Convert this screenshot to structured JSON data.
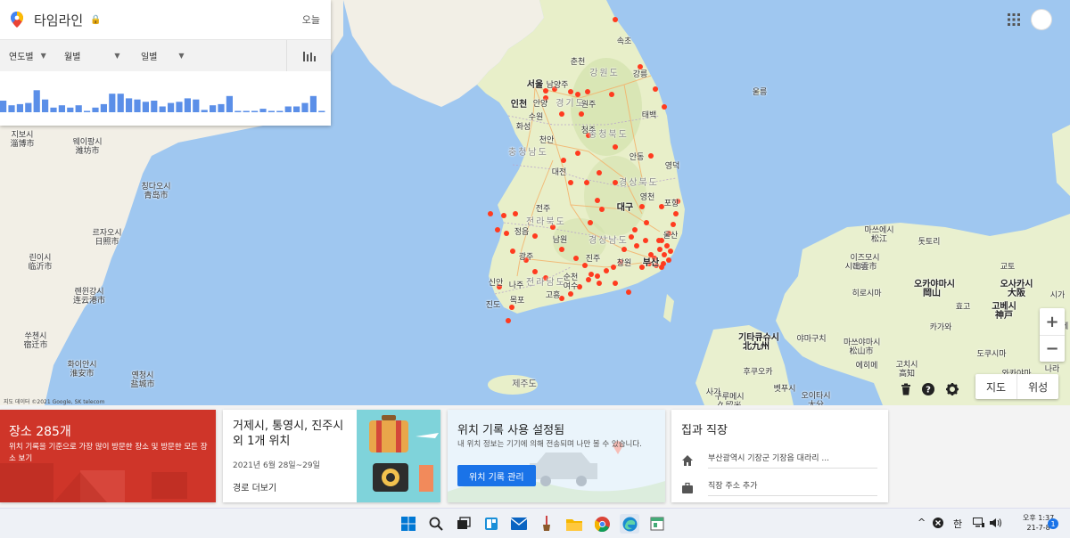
{
  "timeline": {
    "title": "타임라인",
    "today": "오늘",
    "filters": {
      "year": "연도별",
      "month": "월별",
      "day": "일별"
    },
    "activity_bars": [
      0.5,
      0.3,
      0.35,
      0.4,
      0.95,
      0.55,
      0.2,
      0.3,
      0.2,
      0.3,
      0.05,
      0.2,
      0.35,
      0.8,
      0.8,
      0.6,
      0.55,
      0.45,
      0.5,
      0.25,
      0.4,
      0.45,
      0.6,
      0.55,
      0.1,
      0.3,
      0.35,
      0.7,
      0.05,
      0.05,
      0.05,
      0.15,
      0.05,
      0.05,
      0.25,
      0.25,
      0.4,
      0.7,
      0.05
    ]
  },
  "map": {
    "labels": [
      {
        "text": "서울",
        "cls": "big"
      },
      {
        "text": "인천",
        "cls": "big"
      },
      {
        "text": "춘천",
        "cls": ""
      },
      {
        "text": "강릉",
        "cls": ""
      },
      {
        "text": "속초",
        "cls": ""
      },
      {
        "text": "원주",
        "cls": ""
      },
      {
        "text": "수원",
        "cls": ""
      },
      {
        "text": "안양",
        "cls": ""
      },
      {
        "text": "화성",
        "cls": ""
      },
      {
        "text": "남양주",
        "cls": ""
      },
      {
        "text": "천안",
        "cls": ""
      },
      {
        "text": "청주",
        "cls": ""
      },
      {
        "text": "대전",
        "cls": ""
      },
      {
        "text": "전주",
        "cls": ""
      },
      {
        "text": "광주",
        "cls": ""
      },
      {
        "text": "대구",
        "cls": "big"
      },
      {
        "text": "울산",
        "cls": ""
      },
      {
        "text": "부산",
        "cls": "big"
      },
      {
        "text": "포항",
        "cls": ""
      },
      {
        "text": "안동",
        "cls": ""
      },
      {
        "text": "영천",
        "cls": ""
      },
      {
        "text": "영덕",
        "cls": ""
      },
      {
        "text": "태백",
        "cls": ""
      },
      {
        "text": "강원도",
        "cls": "region"
      },
      {
        "text": "경기도",
        "cls": "region"
      },
      {
        "text": "충청북도",
        "cls": "region"
      },
      {
        "text": "충청남도",
        "cls": "region"
      },
      {
        "text": "경상북도",
        "cls": "region"
      },
      {
        "text": "전라북도",
        "cls": "region"
      },
      {
        "text": "경상남도",
        "cls": "region"
      },
      {
        "text": "전라남도",
        "cls": "region"
      },
      {
        "text": "제주도",
        "cls": "jeju"
      },
      {
        "text": "울릉",
        "cls": ""
      },
      {
        "text": "창원",
        "cls": ""
      },
      {
        "text": "진주",
        "cls": ""
      },
      {
        "text": "순천",
        "cls": ""
      },
      {
        "text": "목포",
        "cls": ""
      },
      {
        "text": "여수",
        "cls": ""
      },
      {
        "text": "남원",
        "cls": ""
      },
      {
        "text": "고흥",
        "cls": ""
      },
      {
        "text": "신안",
        "cls": ""
      },
      {
        "text": "진도",
        "cls": ""
      },
      {
        "text": "나주",
        "cls": ""
      },
      {
        "text": "정읍",
        "cls": ""
      },
      {
        "text": "웨이팡시\n潍坊市",
        "cls": ""
      },
      {
        "text": "칭다오시\n青岛市",
        "cls": ""
      },
      {
        "text": "르자오시\n日照市",
        "cls": ""
      },
      {
        "text": "린이시\n临沂市",
        "cls": ""
      },
      {
        "text": "롄윈강시\n连云港市",
        "cls": ""
      },
      {
        "text": "쑤첸시\n宿迁市",
        "cls": ""
      },
      {
        "text": "화이안시\n淮安市",
        "cls": ""
      },
      {
        "text": "옌청시\n盐城市",
        "cls": ""
      },
      {
        "text": "지보시\n淄博市",
        "cls": ""
      },
      {
        "text": "기타큐슈시\n北九州",
        "cls": "big"
      },
      {
        "text": "마쓰에시\n松江",
        "cls": ""
      },
      {
        "text": "돗토리",
        "cls": ""
      },
      {
        "text": "오카야마시\n岡山",
        "cls": "big"
      },
      {
        "text": "오사카시\n大阪",
        "cls": "big"
      },
      {
        "text": "고베시\n神戸",
        "cls": "big"
      },
      {
        "text": "히로시마",
        "cls": ""
      },
      {
        "text": "야마구치",
        "cls": ""
      },
      {
        "text": "마쓰야마시\n松山市",
        "cls": ""
      },
      {
        "text": "고치시\n高知",
        "cls": ""
      },
      {
        "text": "후쿠오카",
        "cls": ""
      },
      {
        "text": "구루메시\n久留米",
        "cls": ""
      },
      {
        "text": "오이타시\n大分",
        "cls": ""
      },
      {
        "text": "벳푸시",
        "cls": ""
      },
      {
        "text": "사가",
        "cls": ""
      },
      {
        "text": "시마네",
        "cls": ""
      },
      {
        "text": "이즈모시\n出雲市",
        "cls": ""
      },
      {
        "text": "효고",
        "cls": ""
      },
      {
        "text": "교토",
        "cls": ""
      },
      {
        "text": "카가와",
        "cls": ""
      },
      {
        "text": "에히메",
        "cls": ""
      },
      {
        "text": "도쿠시마",
        "cls": ""
      },
      {
        "text": "와카야마",
        "cls": ""
      },
      {
        "text": "시가",
        "cls": ""
      },
      {
        "text": "미에",
        "cls": ""
      },
      {
        "text": "나라",
        "cls": ""
      },
      {
        "text": "카가와",
        "cls": ""
      },
      {
        "text": "울릉군",
        "cls": ""
      }
    ],
    "attribution": "지도 데이터 ©2021 Google, SK telecom",
    "map_type": [
      "지도",
      "위성"
    ]
  },
  "cards": {
    "places": {
      "title": "장소 285개",
      "desc": "위치 기록을 기준으로 가장 많이 방문한 장소 및 방문한 모든 장소 보기"
    },
    "trip": {
      "title": "거제시, 통영시, 진주시 외 1개 위치",
      "date": "2021년 6월 28일~29일",
      "link": "경로 더보기"
    },
    "history": {
      "title": "위치 기록 사용 설정됨",
      "desc": "내 위치 정보는 기기에 의해 전송되며 나만 볼 수 있습니다.",
      "button": "위치 기록 관리"
    },
    "home": {
      "title": "집과 직장",
      "home_addr": "부산광역시 기장군 기장읍 대라리 ...",
      "work": "직장 주소 추가"
    }
  },
  "taskbar": {
    "tray_lang": "한",
    "time": "오후 1:37",
    "date": "21-7-8",
    "notif_count": "1"
  },
  "colors": {
    "accent": "#1a73e8",
    "places_card": "#cf3529",
    "marker": "#ff3b1f",
    "water": "#9fc7f0",
    "land": "#f2efe6"
  }
}
